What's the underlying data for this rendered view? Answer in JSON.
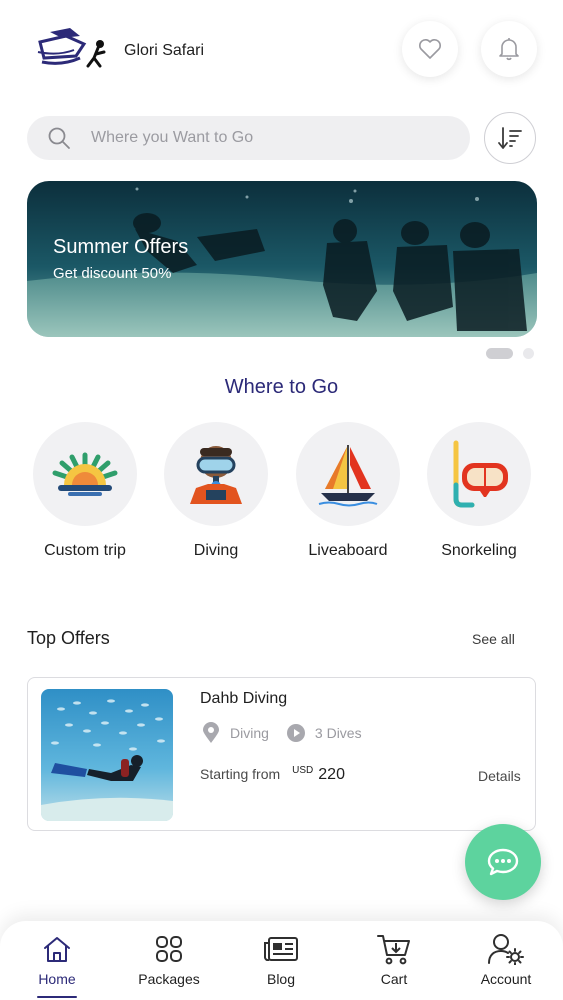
{
  "header": {
    "brand_name": "Glori Safari",
    "favorites_icon": "heart-icon",
    "notifications_icon": "bell-icon"
  },
  "search": {
    "placeholder": "Where you Want to Go",
    "value": "",
    "icon": "search-icon",
    "sort_icon": "sort-icon"
  },
  "banner": {
    "title": "Summer Offers",
    "subtitle": "Get discount 50%",
    "slides_count": 2,
    "active_slide": 1
  },
  "where_to_go": {
    "title": "Where to Go",
    "categories": [
      {
        "label": "Custom trip",
        "icon": "sunrise-icon"
      },
      {
        "label": "Diving",
        "icon": "diver-icon"
      },
      {
        "label": "Liveaboard",
        "icon": "sailboat-icon"
      },
      {
        "label": "Snorkeling",
        "icon": "snorkel-mask-icon"
      }
    ]
  },
  "top_offers": {
    "title": "Top Offers",
    "see_all": "See all",
    "items": [
      {
        "name": "Dahb Diving",
        "type": "Diving",
        "dives": "3 Dives",
        "starting_from": "Starting from",
        "currency": "USD",
        "price": "220",
        "details": "Details"
      }
    ]
  },
  "chat": {
    "icon": "chat-bubble-icon"
  },
  "bottom_nav": {
    "items": [
      {
        "label": "Home",
        "icon": "home-icon",
        "active": true
      },
      {
        "label": "Packages",
        "icon": "grid-icon",
        "active": false
      },
      {
        "label": "Blog",
        "icon": "newspaper-icon",
        "active": false
      },
      {
        "label": "Cart",
        "icon": "cart-icon",
        "active": false
      },
      {
        "label": "Account",
        "icon": "user-settings-icon",
        "active": false
      }
    ]
  },
  "colors": {
    "primary": "#2c2a78",
    "chat_fab": "#5dd39e",
    "search_bg": "#efeff1"
  }
}
